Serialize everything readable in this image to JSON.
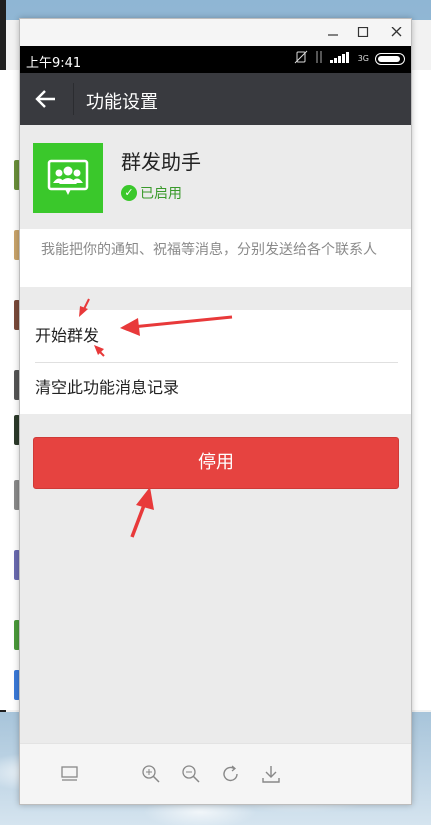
{
  "status_bar": {
    "time": "上午9:41",
    "network": "3G"
  },
  "app_bar": {
    "title": "功能设置"
  },
  "feature": {
    "name": "群发助手",
    "status": "已启用",
    "description": "我能把你的通知、祝福等消息，分别发送给各个联系人"
  },
  "menu": {
    "items": [
      {
        "label": "开始群发"
      },
      {
        "label": "清空此功能消息记录"
      }
    ]
  },
  "actions": {
    "disable_label": "停用"
  },
  "colors": {
    "app_bar": "#393a3f",
    "accent_green": "#3ac82b",
    "danger_red": "#e64340",
    "annotation_arrow": "#e8393a"
  },
  "toolbar": {
    "icons": [
      "screen-icon",
      "zoom-in-icon",
      "zoom-out-icon",
      "rotate-icon",
      "download-icon"
    ]
  }
}
